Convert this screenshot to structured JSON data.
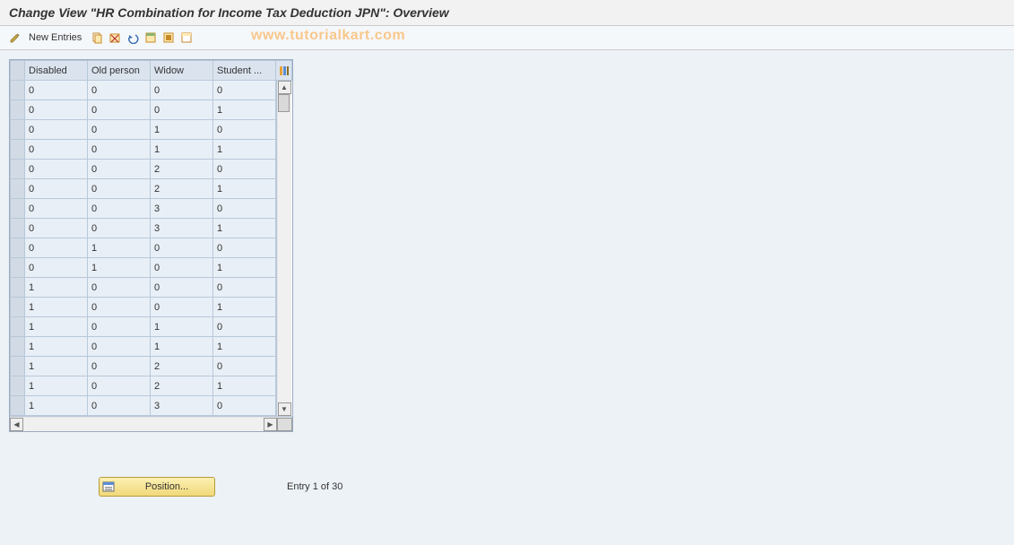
{
  "title": "Change View \"HR Combination for Income Tax Deduction JPN\": Overview",
  "toolbar": {
    "new_entries_label": "New Entries"
  },
  "watermark": "www.tutorialkart.com",
  "table": {
    "columns": [
      "Disabled",
      "Old person",
      "Widow",
      "Student ..."
    ],
    "rows": [
      {
        "disabled": "0",
        "oldperson": "0",
        "widow": "0",
        "student": "0"
      },
      {
        "disabled": "0",
        "oldperson": "0",
        "widow": "0",
        "student": "1"
      },
      {
        "disabled": "0",
        "oldperson": "0",
        "widow": "1",
        "student": "0"
      },
      {
        "disabled": "0",
        "oldperson": "0",
        "widow": "1",
        "student": "1"
      },
      {
        "disabled": "0",
        "oldperson": "0",
        "widow": "2",
        "student": "0"
      },
      {
        "disabled": "0",
        "oldperson": "0",
        "widow": "2",
        "student": "1"
      },
      {
        "disabled": "0",
        "oldperson": "0",
        "widow": "3",
        "student": "0"
      },
      {
        "disabled": "0",
        "oldperson": "0",
        "widow": "3",
        "student": "1"
      },
      {
        "disabled": "0",
        "oldperson": "1",
        "widow": "0",
        "student": "0"
      },
      {
        "disabled": "0",
        "oldperson": "1",
        "widow": "0",
        "student": "1"
      },
      {
        "disabled": "1",
        "oldperson": "0",
        "widow": "0",
        "student": "0"
      },
      {
        "disabled": "1",
        "oldperson": "0",
        "widow": "0",
        "student": "1"
      },
      {
        "disabled": "1",
        "oldperson": "0",
        "widow": "1",
        "student": "0"
      },
      {
        "disabled": "1",
        "oldperson": "0",
        "widow": "1",
        "student": "1"
      },
      {
        "disabled": "1",
        "oldperson": "0",
        "widow": "2",
        "student": "0"
      },
      {
        "disabled": "1",
        "oldperson": "0",
        "widow": "2",
        "student": "1"
      },
      {
        "disabled": "1",
        "oldperson": "0",
        "widow": "3",
        "student": "0"
      }
    ]
  },
  "footer": {
    "position_label": "Position...",
    "entry_text": "Entry 1 of 30"
  }
}
